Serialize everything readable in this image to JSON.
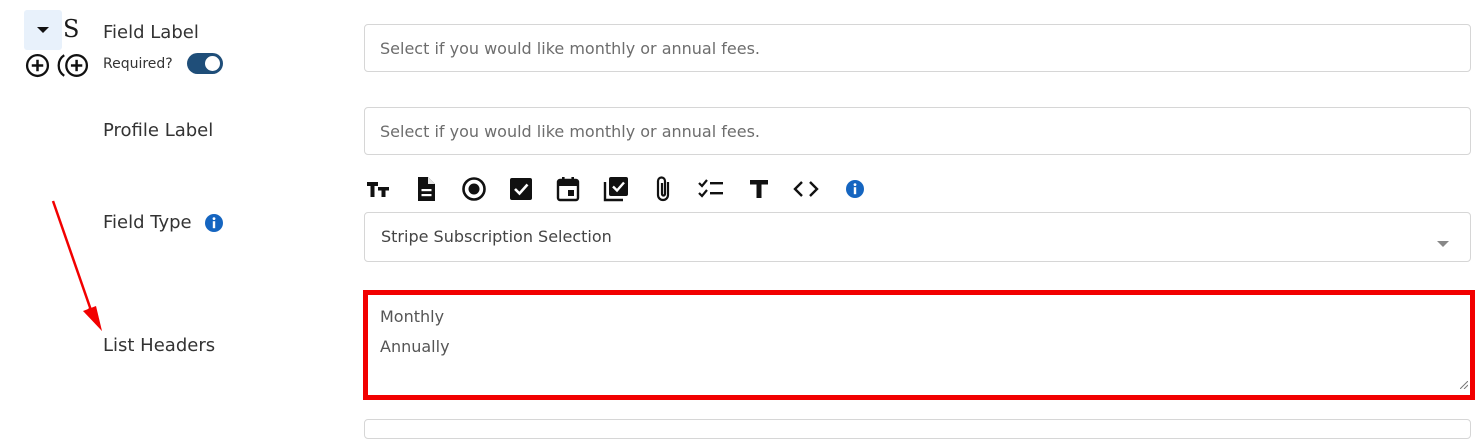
{
  "header": {
    "letter": "S",
    "collapse_icon": "caret-down-icon",
    "add_icons": [
      "add-circle-icon",
      "add-circle-nested-icon"
    ]
  },
  "field_label": {
    "label": "Field Label",
    "placeholder": "Select if you would like monthly or annual fees.",
    "required_label": "Required?",
    "required_on": true
  },
  "profile_label": {
    "label": "Profile Label",
    "placeholder": "Select if you would like monthly or annual fees."
  },
  "toolbar": {
    "icons": [
      "text-size-icon",
      "document-icon",
      "radio-icon",
      "checkbox-icon",
      "calendar-icon",
      "multi-checkbox-icon",
      "paperclip-icon",
      "checklist-icon",
      "text-icon",
      "code-icon",
      "info-icon"
    ]
  },
  "field_type": {
    "label": "Field Type",
    "value": "Stripe Subscription Selection",
    "info_icon": "info-icon"
  },
  "list_headers": {
    "label": "List Headers",
    "lines": [
      "Monthly",
      "Annually"
    ]
  },
  "colors": {
    "toggle": "#1f4e79",
    "info": "#1565c0",
    "highlight": "#f20000",
    "arrow": "#f20000"
  }
}
